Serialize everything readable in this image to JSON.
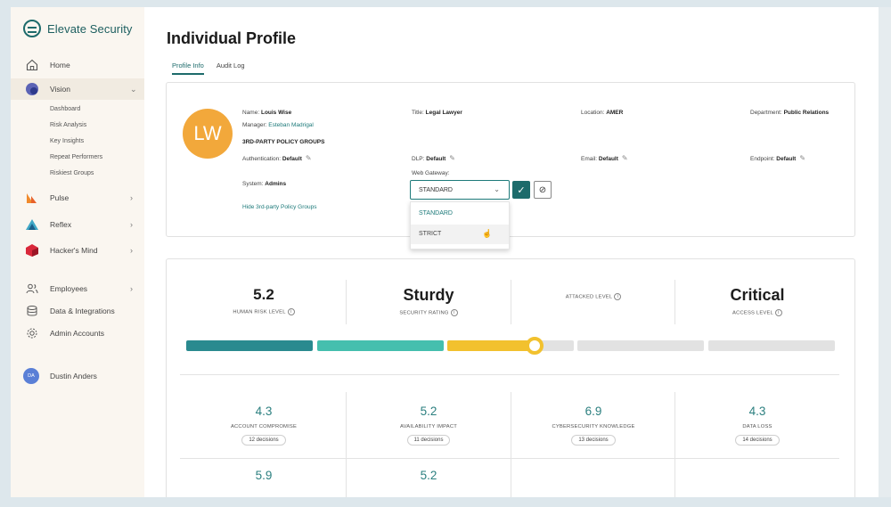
{
  "app": {
    "name": "Elevate Security"
  },
  "sidebar": {
    "items": [
      {
        "label": "Home",
        "icon": "home-icon"
      },
      {
        "label": "Vision",
        "icon": "vision-icon"
      },
      {
        "label": "Pulse",
        "icon": "pulse-icon"
      },
      {
        "label": "Reflex",
        "icon": "reflex-icon"
      },
      {
        "label": "Hacker's Mind",
        "icon": "hackers-mind-icon"
      },
      {
        "label": "Employees",
        "icon": "employees-icon"
      },
      {
        "label": "Data & Integrations",
        "icon": "data-integrations-icon"
      },
      {
        "label": "Admin Accounts",
        "icon": "admin-accounts-icon"
      }
    ],
    "vision_sub": [
      "Dashboard",
      "Risk Analysis",
      "Key Insights",
      "Repeat Performers",
      "Riskiest Groups"
    ],
    "user": {
      "initials": "DA",
      "name": "Dustin Anders"
    }
  },
  "page": {
    "title": "Individual Profile",
    "tabs": [
      {
        "label": "Profile Info"
      },
      {
        "label": "Audit Log"
      }
    ]
  },
  "profile": {
    "initials": "LW",
    "name_label": "Name:",
    "name": "Louis Wise",
    "title_label": "Title:",
    "title": "Legal Lawyer",
    "location_label": "Location:",
    "location": "AMER",
    "department_label": "Department:",
    "department": "Public Relations",
    "manager_label": "Manager:",
    "manager": "Esteban Madrigal",
    "groups_heading": "3RD-PARTY POLICY GROUPS",
    "auth_label": "Authentication:",
    "auth": "Default",
    "dlp_label": "DLP:",
    "dlp": "Default",
    "email_label": "Email:",
    "email": "Default",
    "endpoint_label": "Endpoint:",
    "endpoint": "Default",
    "system_label": "System:",
    "system": "Admins",
    "web_gateway_label": "Web Gateway:",
    "web_gateway_value": "STANDARD",
    "web_gateway_options": [
      "STANDARD",
      "STRICT"
    ],
    "hide_link": "Hide 3rd-party Policy Groups"
  },
  "metrics": {
    "human_risk": {
      "value": "5.2",
      "label": "HUMAN RISK LEVEL"
    },
    "security_rating": {
      "value": "Sturdy",
      "label": "SECURITY RATING"
    },
    "attacked": {
      "value": "",
      "label": "ATTACKED LEVEL"
    },
    "access": {
      "value": "Critical",
      "label": "ACCESS LEVEL"
    },
    "risk_scale_position": 0.55
  },
  "submetrics": [
    {
      "value": "4.3",
      "label": "ACCOUNT COMPROMISE",
      "decisions": "12 decisions"
    },
    {
      "value": "5.2",
      "label": "AVAILABILITY IMPACT",
      "decisions": "11 decisions"
    },
    {
      "value": "6.9",
      "label": "CYBERSECURITY KNOWLEDGE",
      "decisions": "13 decisions"
    },
    {
      "value": "4.3",
      "label": "DATA LOSS",
      "decisions": "14 decisions"
    },
    {
      "value": "5.9",
      "label": "",
      "decisions": ""
    },
    {
      "value": "5.2",
      "label": "",
      "decisions": ""
    }
  ],
  "colors": {
    "accent": "#1d6b6b",
    "seg1": "#2a8a8f",
    "seg2": "#45bfae",
    "seg3": "#f2c12e",
    "seg_empty": "#e2e2e2",
    "avatar": "#f2a83b"
  }
}
